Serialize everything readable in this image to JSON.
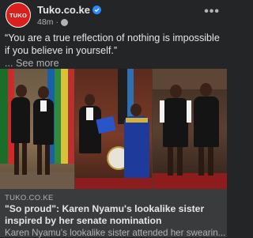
{
  "post": {
    "page_name": "Tuko.co.ke",
    "avatar_text": "TUKO",
    "time": "48m",
    "separator": "·",
    "caption": "“You are a true reflection of nothing is impossible if you believe in yourself.”",
    "see_more": "... See more",
    "more_options": "•••"
  },
  "link_card": {
    "domain": "TUKO.CO.KE",
    "headline": "\"So proud\": Karen Nyamu's lookalike sister inspired by her senate nomination",
    "description": "Karen Nyamu's lookalike sister attended her swearin..."
  },
  "colors": {
    "background": "#242526",
    "card": "#3a3b3c",
    "brand_red": "#d9201c",
    "verified_blue": "#2d88ff"
  },
  "icons": [
    "verified-badge-icon",
    "globe-icon",
    "more-options-icon"
  ]
}
